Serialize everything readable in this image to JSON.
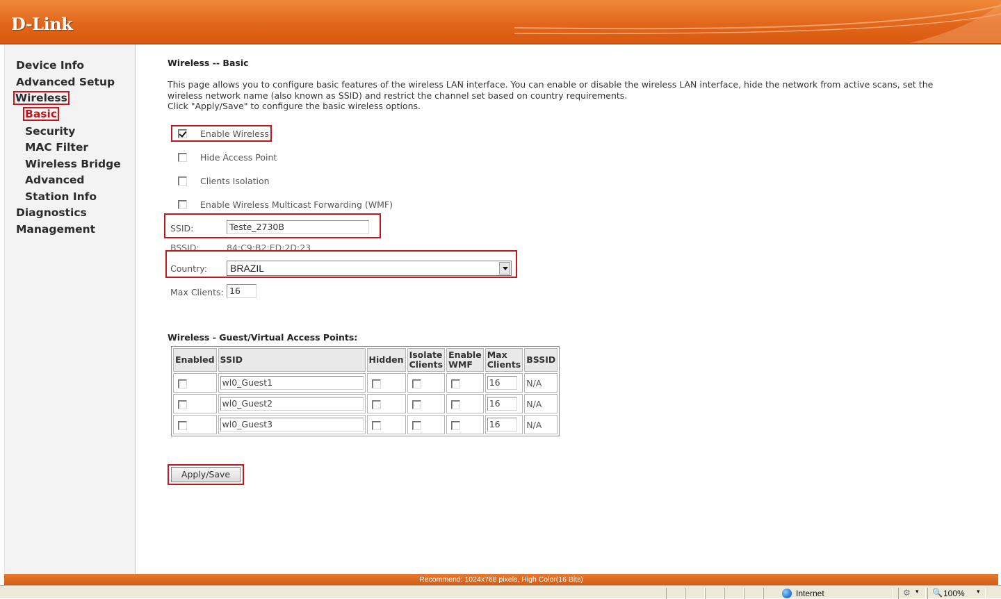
{
  "brand": {
    "logo_text": "D-Link",
    "accent_color": "#e2661c",
    "highlight_color": "#c4161c"
  },
  "sidebar": {
    "items": [
      {
        "label": "Device Info"
      },
      {
        "label": "Advanced Setup"
      },
      {
        "label": "Wireless",
        "selected": true
      },
      {
        "label": "Basic",
        "selected": true
      },
      {
        "label": "Security"
      },
      {
        "label": "MAC Filter"
      },
      {
        "label": "Wireless Bridge"
      },
      {
        "label": "Advanced"
      },
      {
        "label": "Station Info"
      },
      {
        "label": "Diagnostics"
      },
      {
        "label": "Management"
      }
    ]
  },
  "page": {
    "title": "Wireless -- Basic",
    "description_line1": "This page allows you to configure basic features of the wireless LAN interface. You can enable or disable the wireless LAN interface, hide the network from active scans, set the wireless network name (also known as SSID) and restrict the channel set based on country requirements.",
    "description_line2": "Click \"Apply/Save\" to configure the basic wireless options."
  },
  "options": {
    "enable_wireless": {
      "label": "Enable Wireless",
      "checked": true
    },
    "hide_access_point": {
      "label": "Hide Access Point",
      "checked": false
    },
    "clients_isolation": {
      "label": "Clients Isolation",
      "checked": false
    },
    "enable_wmf": {
      "label": "Enable Wireless Multicast Forwarding (WMF)",
      "checked": false
    }
  },
  "fields": {
    "ssid_label": "SSID:",
    "ssid_value": "Teste_2730B",
    "bssid_label": "BSSID:",
    "bssid_value": "84:C9:B2:ED:2D:23",
    "country_label": "Country:",
    "country_value": "BRAZIL",
    "max_clients_label": "Max Clients:",
    "max_clients_value": "16"
  },
  "guest_section": {
    "title": "Wireless - Guest/Virtual Access Points:",
    "headers": {
      "enabled": "Enabled",
      "ssid": "SSID",
      "hidden": "Hidden",
      "isolate_1": "Isolate",
      "isolate_2": "Clients",
      "wmf_1": "Enable",
      "wmf_2": "WMF",
      "max_1": "Max",
      "max_2": "Clients",
      "bssid": "BSSID"
    },
    "rows": [
      {
        "ssid": "wl0_Guest1",
        "max_clients": "16",
        "bssid": "N/A"
      },
      {
        "ssid": "wl0_Guest2",
        "max_clients": "16",
        "bssid": "N/A"
      },
      {
        "ssid": "wl0_Guest3",
        "max_clients": "16",
        "bssid": "N/A"
      }
    ]
  },
  "actions": {
    "apply_label": "Apply/Save"
  },
  "footer": {
    "text": "Recommend: 1024x768 pixels, High Color(16 Bits)"
  },
  "browser_status": {
    "zone": "Internet",
    "zoom": "100%"
  }
}
